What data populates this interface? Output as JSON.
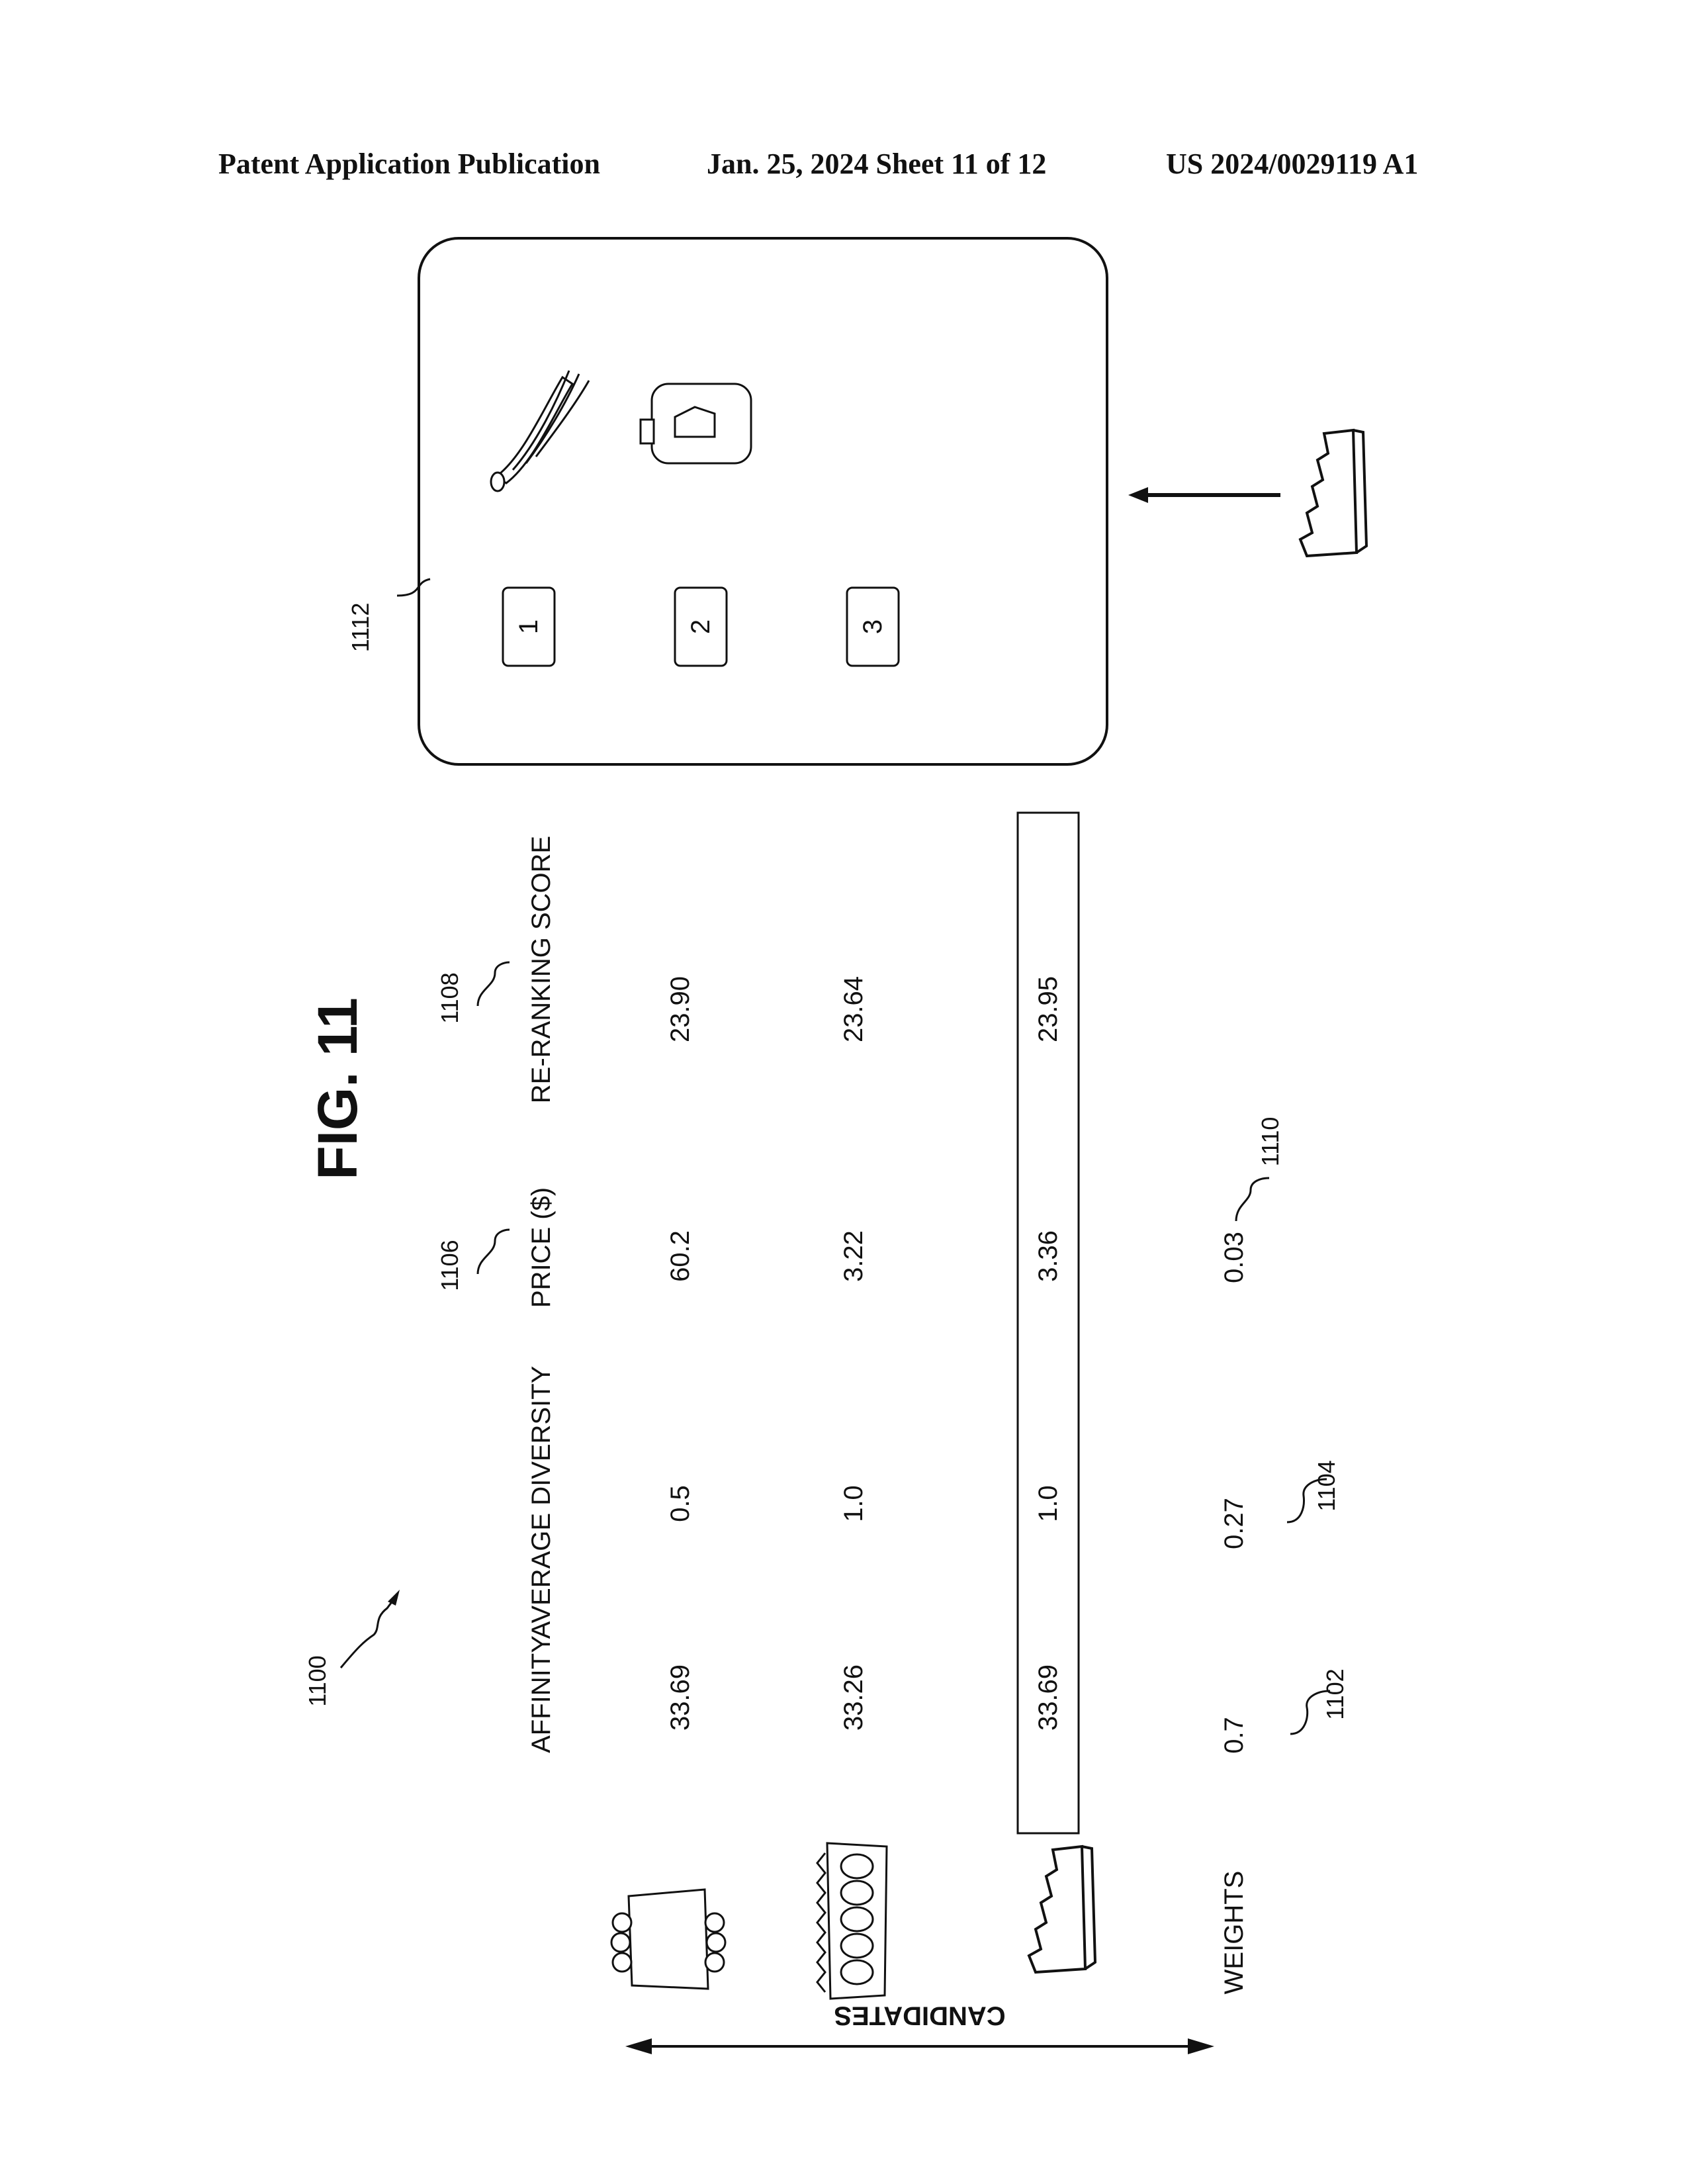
{
  "header": {
    "publication": "Patent Application Publication",
    "date_sheet": "Jan. 25, 2024  Sheet 11 of 12",
    "pub_number": "US 2024/0029119 A1"
  },
  "figure": {
    "title": "FIG. 11",
    "ref_main": "1100",
    "axis_label": "CANDIDATES",
    "columns": [
      "AFFINITY",
      "AVERAGE DIVERSITY",
      "PRICE ($)",
      "RE-RANKING SCORE"
    ],
    "column_refs": {
      "price": "1106",
      "score": "1108"
    },
    "rows": [
      {
        "icon": "egg-carton-icon",
        "affinity": "33.69",
        "diversity": "0.5",
        "price": "60.2",
        "score": "23.90"
      },
      {
        "icon": "egg-tray-icon",
        "affinity": "33.26",
        "diversity": "1.0",
        "price": "3.22",
        "score": "23.64"
      },
      {
        "icon": "bread-loaf-icon",
        "affinity": "33.69",
        "diversity": "1.0",
        "price": "3.36",
        "score": "23.95"
      }
    ],
    "weights": {
      "label": "WEIGHTS",
      "affinity": "0.7",
      "diversity": "0.27",
      "price": "0.03"
    },
    "weight_refs": {
      "affinity": "1102",
      "diversity": "1104",
      "price": "1110"
    },
    "panel": {
      "ref": "1112",
      "slots": [
        "1",
        "2",
        "3"
      ],
      "items": [
        "bananas-icon",
        "milk-jug-icon"
      ],
      "incoming_item": "bread-loaf-icon"
    }
  }
}
